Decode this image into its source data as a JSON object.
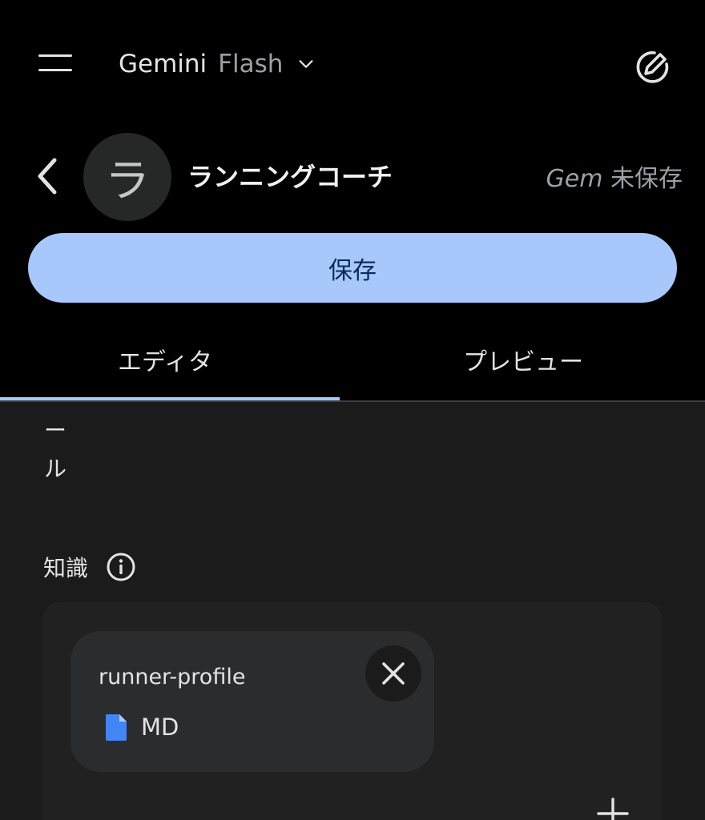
{
  "topbar": {
    "app_name": "Gemini",
    "model_name": "Flash",
    "menu_icon": "hamburger-menu-icon",
    "chevron_icon": "chevron-down-icon",
    "new_chat_icon": "edit-pen-icon"
  },
  "gem": {
    "avatar_letter": "ラ",
    "title": "ランニングコーチ",
    "status_prefix": "Gem",
    "status_suffix": "未保存"
  },
  "save_button": {
    "label": "保存"
  },
  "tabs": [
    {
      "label": "エディタ",
      "active": true
    },
    {
      "label": "プレビュー",
      "active": false
    }
  ],
  "editor": {
    "vertical_fragment": [
      "ー",
      "ル"
    ]
  },
  "knowledge": {
    "label": "知識",
    "files": [
      {
        "name": "runner-profile",
        "type": "MD"
      }
    ]
  },
  "colors": {
    "accent": "#a8c7fa",
    "background": "#000000",
    "surface": "#1b1b1b",
    "card": "#2b2c2e",
    "doc_icon": "#4285f4"
  }
}
